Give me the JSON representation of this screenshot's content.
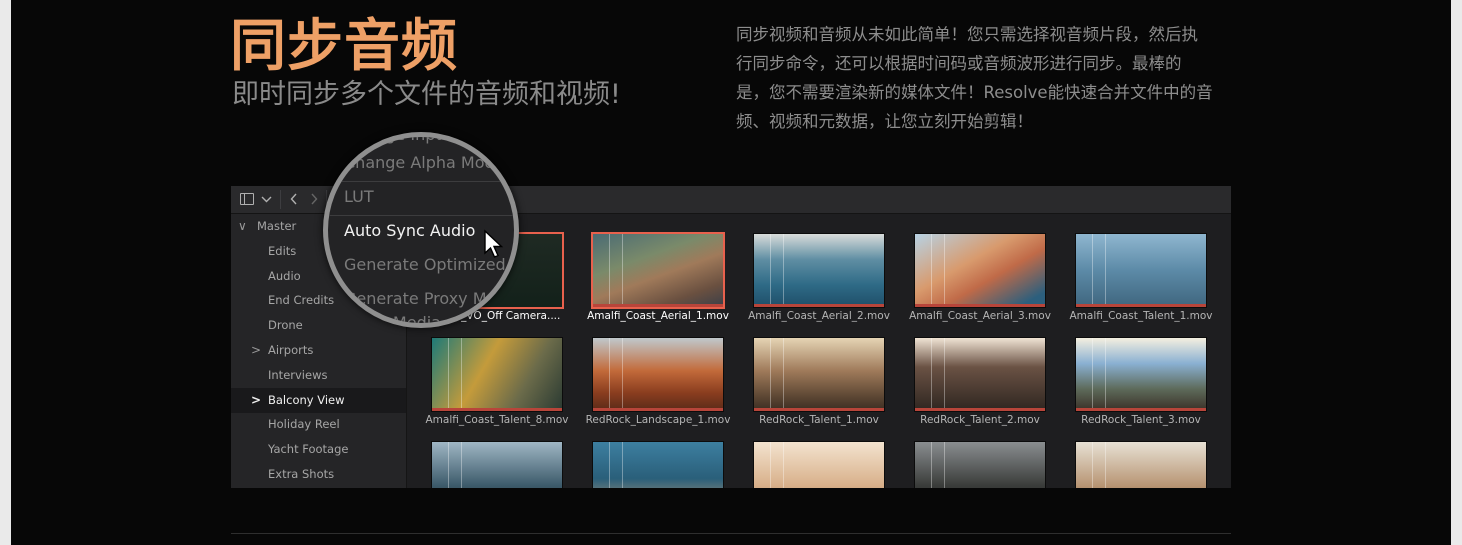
{
  "hero": {
    "title": "同步音频",
    "subtitle": "即时同步多个文件的音频和视频!",
    "description": "同步视频和音频从未如此简单！您只需选择视音频片段，然后执行同步命令，还可以根据时间码或音频波形进行同步。最棒的是，您不需要渲染新的媒体文件！Resolve能快速合并文件中的音频、视频和元数据，让您立刻开始剪辑！"
  },
  "colors": {
    "title": "#eea066",
    "selection_border": "#e8614d",
    "background": "#070707"
  },
  "toolbar": {
    "icons": [
      "panel-toggle-icon",
      "chevron-down-icon",
      "back-arrow-icon",
      "forward-arrow-icon"
    ]
  },
  "sidebar": {
    "bins": [
      {
        "label": "Master",
        "chevron": "∨",
        "level": 0
      },
      {
        "label": "Edits",
        "level": 1
      },
      {
        "label": "Audio",
        "level": 1
      },
      {
        "label": "End Credits",
        "level": 1
      },
      {
        "label": "Drone",
        "level": 1
      },
      {
        "label": "Airports",
        "chevron": ">",
        "level": 1
      },
      {
        "label": "Interviews",
        "level": 1
      },
      {
        "label": "Balcony View",
        "chevron": ">",
        "level": 1,
        "selected": true
      },
      {
        "label": "Holiday Reel",
        "level": 1
      },
      {
        "label": "Yacht Footage",
        "level": 1
      },
      {
        "label": "Extra Shots",
        "level": 1
      }
    ]
  },
  "clips": [
    {
      "name": "Brian_VO_Off Camera....",
      "selected": true,
      "kind": "audio"
    },
    {
      "name": "Amalfi_Coast_Aerial_1.mov",
      "selected": true
    },
    {
      "name": "Amalfi_Coast_Aerial_2.mov"
    },
    {
      "name": "Amalfi_Coast_Aerial_3.mov"
    },
    {
      "name": "Amalfi_Coast_Talent_1.mov"
    },
    {
      "name": "Amalfi_Coast_Talent_8.mov"
    },
    {
      "name": "RedRock_Landscape_1.mov"
    },
    {
      "name": "RedRock_Talent_1.mov"
    },
    {
      "name": "RedRock_Talent_2.mov"
    },
    {
      "name": "RedRock_Talent_3.mov"
    },
    {
      "name": ""
    },
    {
      "name": ""
    },
    {
      "name": ""
    },
    {
      "name": ""
    },
    {
      "name": ""
    }
  ],
  "context_menu": {
    "items": [
      {
        "label": "Change Input..."
      },
      {
        "label": "Change Alpha Mode"
      },
      {
        "label": "LUT"
      },
      {
        "label": "Auto Sync Audio",
        "active": true
      },
      {
        "label": "Generate Optimized Media"
      },
      {
        "label": "Generate Proxy Media"
      },
      {
        "label": "Proxy Media"
      }
    ]
  }
}
